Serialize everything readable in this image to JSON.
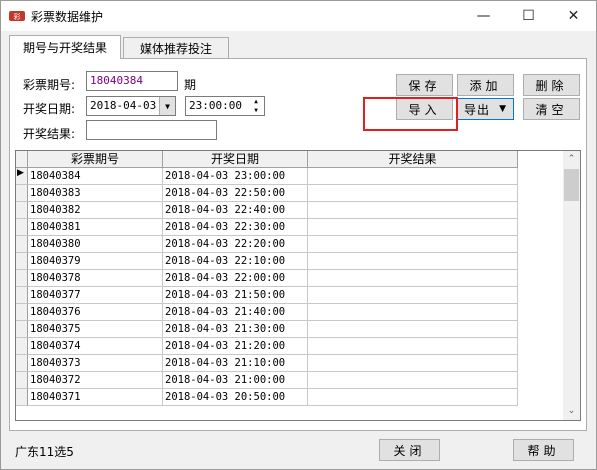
{
  "window": {
    "title": "彩票数据维护",
    "minimize": "—",
    "maximize": "☐",
    "close": "✕"
  },
  "tabs": [
    {
      "label": "期号与开奖结果"
    },
    {
      "label": "媒体推荐投注"
    }
  ],
  "form": {
    "issue_label": "彩票期号:",
    "issue_value": "18040384",
    "issue_suffix": "期",
    "date_label": "开奖日期:",
    "date_value": "2018-04-03",
    "time_value": "23:00:00",
    "result_label": "开奖结果:",
    "result_value": ""
  },
  "buttons": {
    "save": "保存",
    "add": "添加",
    "delete": "删除",
    "import": "导入",
    "export": "导出",
    "clear": "清空",
    "close": "关闭",
    "help": "帮助"
  },
  "table": {
    "headers": [
      "彩票期号",
      "开奖日期",
      "开奖结果"
    ],
    "rows": [
      [
        "18040384",
        "2018-04-03 23:00:00",
        ""
      ],
      [
        "18040383",
        "2018-04-03 22:50:00",
        ""
      ],
      [
        "18040382",
        "2018-04-03 22:40:00",
        ""
      ],
      [
        "18040381",
        "2018-04-03 22:30:00",
        ""
      ],
      [
        "18040380",
        "2018-04-03 22:20:00",
        ""
      ],
      [
        "18040379",
        "2018-04-03 22:10:00",
        ""
      ],
      [
        "18040378",
        "2018-04-03 22:00:00",
        ""
      ],
      [
        "18040377",
        "2018-04-03 21:50:00",
        ""
      ],
      [
        "18040376",
        "2018-04-03 21:40:00",
        ""
      ],
      [
        "18040375",
        "2018-04-03 21:30:00",
        ""
      ],
      [
        "18040374",
        "2018-04-03 21:20:00",
        ""
      ],
      [
        "18040373",
        "2018-04-03 21:10:00",
        ""
      ],
      [
        "18040372",
        "2018-04-03 21:00:00",
        ""
      ],
      [
        "18040371",
        "2018-04-03 20:50:00",
        ""
      ]
    ]
  },
  "footer": {
    "lottery_name": "广东11选5"
  },
  "colors": {
    "highlight_box": "#e02020",
    "issue_text": "#800080"
  }
}
